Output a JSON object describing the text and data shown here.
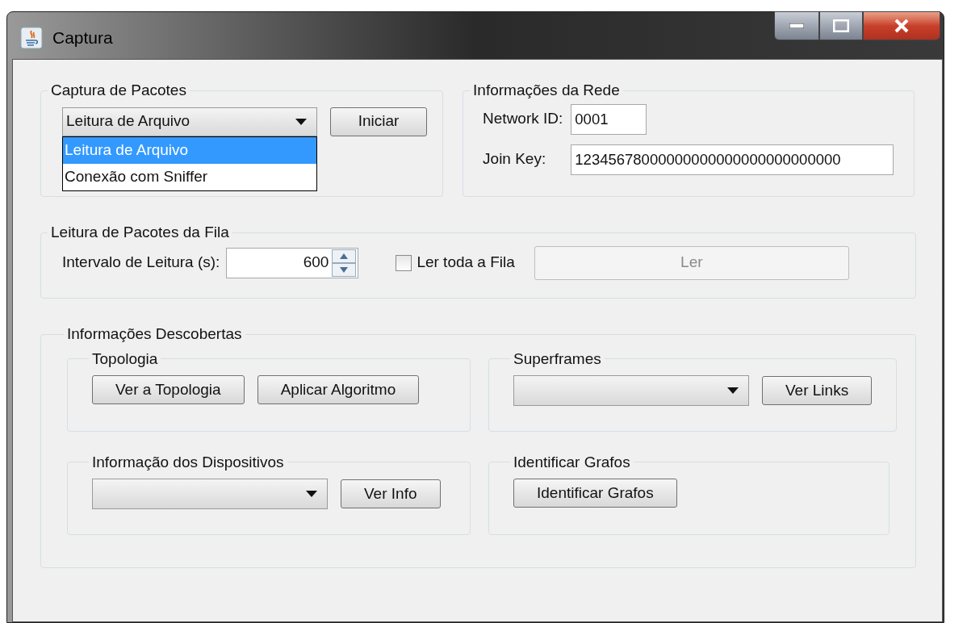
{
  "window": {
    "title": "Captura"
  },
  "capture": {
    "title": "Captura de Pacotes",
    "mode": {
      "value": "Leitura de Arquivo",
      "expanded": true,
      "options": [
        {
          "label": "Leitura de Arquivo",
          "selected": true
        },
        {
          "label": "Conexão com Sniffer",
          "selected": false
        }
      ]
    },
    "start_button": "Iniciar"
  },
  "network": {
    "title": "Informações da Rede",
    "fields": [
      {
        "label": "Network ID:",
        "value": "0001"
      },
      {
        "label": "Join Key:",
        "value": "12345678000000000000000000000000"
      }
    ]
  },
  "queue": {
    "title": "Leitura de Pacotes da Fila",
    "interval_label": "Intervalo de Leitura (s):",
    "interval_value": "600",
    "read_all": {
      "label": "Ler toda a Fila",
      "checked": false
    },
    "read_button": {
      "label": "Ler",
      "disabled": true
    }
  },
  "discovered": {
    "title": "Informações Descobertas",
    "groups": [
      {
        "title": "Topologia",
        "controls": [
          {
            "kind": "button",
            "label": "Ver a Topologia"
          },
          {
            "kind": "button",
            "label": "Aplicar Algoritmo"
          }
        ]
      },
      {
        "title": "Superframes",
        "controls": [
          {
            "kind": "combo"
          },
          {
            "kind": "button",
            "label": "Ver Links"
          }
        ]
      },
      {
        "title": "Informação dos Dispositivos",
        "controls": [
          {
            "kind": "combo"
          },
          {
            "kind": "button",
            "label": "Ver Info"
          }
        ]
      },
      {
        "title": "Identificar Grafos",
        "controls": [
          {
            "kind": "button",
            "label": "Identificar Grafos"
          }
        ]
      }
    ]
  }
}
